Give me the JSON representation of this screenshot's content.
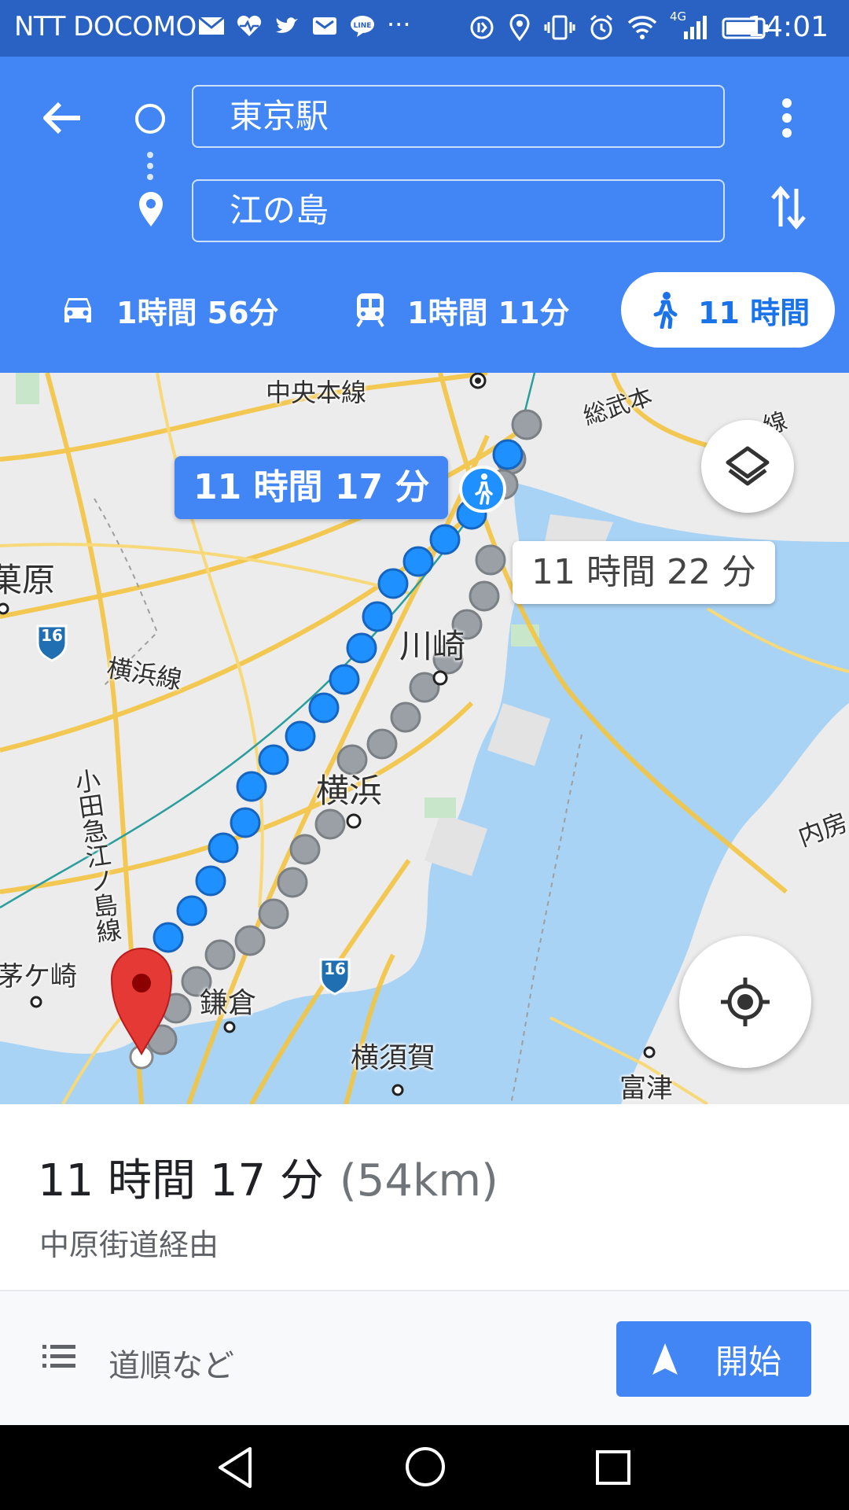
{
  "status_bar": {
    "carrier": "NTT DOCOMO",
    "more": "···",
    "network": "4G",
    "time": "14:01"
  },
  "directions": {
    "origin": "東京駅",
    "destination": "江の島"
  },
  "travel_modes": [
    {
      "mode": "drive",
      "icon": "car-icon",
      "duration": "1時間 56分"
    },
    {
      "mode": "transit",
      "icon": "train-icon",
      "duration": "1時間 11分"
    },
    {
      "mode": "walk",
      "icon": "walk-icon",
      "duration": "11 時間",
      "selected": true
    }
  ],
  "map": {
    "labels": {
      "chuo_line": "中央本線",
      "sobu": "総武本",
      "sen": "線",
      "hara": "菓原",
      "yokohama_line": "横浜線",
      "kawasaki": "川崎",
      "yokohama": "横浜",
      "odakyu": "小田急江ノ島線",
      "chigasaki": "茅ケ崎",
      "kamakura": "鎌倉",
      "yokosuka": "横須賀",
      "futtsu": "富津",
      "uchibo": "内房",
      "route16_a": "16",
      "route16_b": "16"
    },
    "primary_route_callout": "11 時間 17 分",
    "alternate_route_callout": "11 時間 22 分"
  },
  "summary": {
    "duration": "11 時間 17 分",
    "distance": "(54km)",
    "via": "中原街道経由"
  },
  "actions": {
    "steps_label": "道順など",
    "start_label": "開始"
  },
  "colors": {
    "header_blue": "#4285f4",
    "status_blue": "#2a62c4",
    "route_blue": "#1e90ff",
    "route_gray": "#9aa0a6",
    "water": "#a9d3f5",
    "pin_red": "#e53935"
  }
}
